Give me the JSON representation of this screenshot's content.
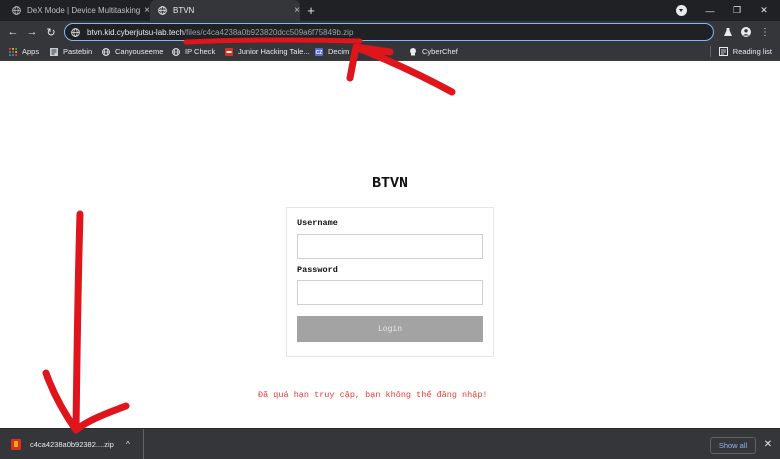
{
  "browser": {
    "tabs": [
      {
        "title": "DeX Mode | Device Multitasking",
        "active": false
      },
      {
        "title": "BTVN",
        "active": true
      }
    ],
    "new_tab_label": "+",
    "url": {
      "host": "btvn.kid.cyberjutsu-lab.tech",
      "path": "/files/c4ca4238a0b923820dcc509a6f75849b.zip"
    },
    "bookmarks": [
      {
        "label": "Apps",
        "icon": "apps-grid-icon"
      },
      {
        "label": "Pastebin",
        "icon": "pastebin-icon"
      },
      {
        "label": "Canyouseeme",
        "icon": "globe-icon"
      },
      {
        "label": "IP Check",
        "icon": "globe-icon"
      },
      {
        "label": "Junior Hacking Tale...",
        "icon": "bookmark-favicon"
      },
      {
        "label": "Decim",
        "icon": "cz-favicon"
      },
      {
        "label": "CyberChef",
        "icon": "chef-hat-icon"
      }
    ],
    "reading_list_label": "Reading list"
  },
  "page": {
    "heading": "BTVN",
    "form": {
      "username_label": "Username",
      "username_value": "",
      "password_label": "Password",
      "password_value": "",
      "login_label": "Login"
    },
    "error_message": "Đã quá hạn truy cập, bạn không thể đăng nhập!"
  },
  "downloads": {
    "file_name": "c4ca4238a0b92382....zip",
    "show_all_label": "Show all"
  },
  "colors": {
    "annotation_red": "#e0141b",
    "error_text": "#e53935",
    "login_button": "#a3a3a3",
    "omnibox_focus": "#8ab4f8"
  }
}
